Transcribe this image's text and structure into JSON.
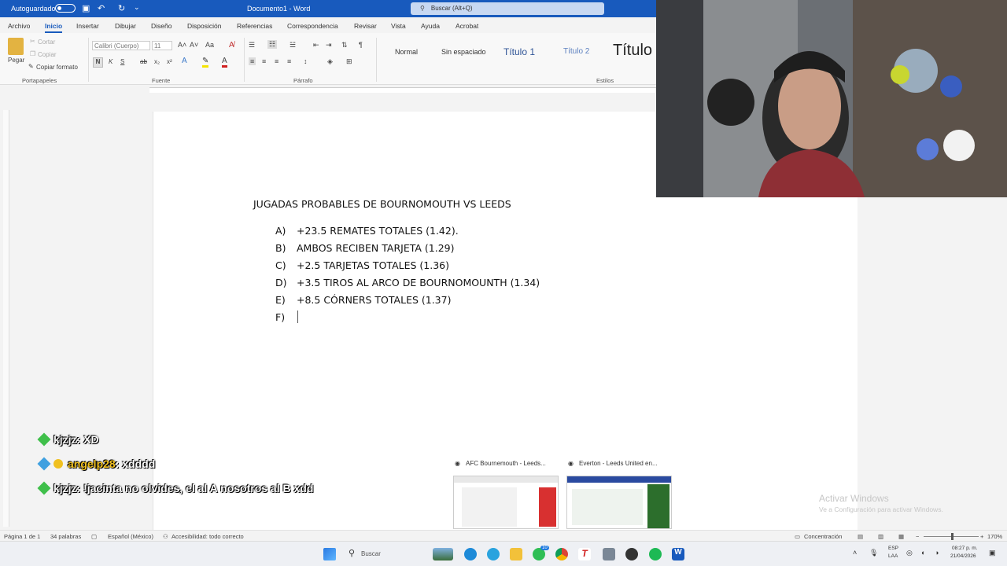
{
  "titlebar": {
    "autosave_label": "Autoguardado",
    "doc_title": "Documento1 - Word",
    "search_placeholder": "Buscar (Alt+Q)"
  },
  "menu": {
    "tabs": [
      "Archivo",
      "Inicio",
      "Insertar",
      "Dibujar",
      "Diseño",
      "Disposición",
      "Referencias",
      "Correspondencia",
      "Revisar",
      "Vista",
      "Ayuda",
      "Acrobat"
    ],
    "active": "Inicio"
  },
  "ribbon": {
    "clipboard": {
      "paste": "Pegar",
      "cut": "Cortar",
      "copy": "Copiar",
      "format_painter": "Copiar formato",
      "label": "Portapapeles"
    },
    "font": {
      "family": "Calibri (Cuerpo)",
      "size": "11",
      "label": "Fuente"
    },
    "paragraph": {
      "label": "Párrafo"
    },
    "styles": {
      "items": [
        "Normal",
        "Sin espaciado",
        "Título 1",
        "Título 2",
        "Título"
      ],
      "label": "Estilos"
    }
  },
  "document": {
    "heading": "JUGADAS PROBABLES DE BOURNOMOUTH VS LEEDS",
    "items": [
      {
        "marker": "A)",
        "text": "+23.5 REMATES TOTALES (1.42)."
      },
      {
        "marker": "B)",
        "text": "AMBOS RECIBEN TARJETA (1.29)"
      },
      {
        "marker": "C)",
        "text": "+2.5 TARJETAS TOTALES (1.36)"
      },
      {
        "marker": "D)",
        "text": "+3.5 TIROS AL ARCO DE BOURNOMOUNTH (1.34)"
      },
      {
        "marker": "E)",
        "text": "+8.5 CÓRNERS TOTALES (1.37)"
      },
      {
        "marker": "F)",
        "text": ""
      }
    ]
  },
  "chat": [
    {
      "user": "kjzjz",
      "message": "XD"
    },
    {
      "user": "angelp28",
      "message": "xdddd"
    },
    {
      "user": "kjzjz",
      "message": "!jacinta no olvides, el al A nosotros al B xdd"
    }
  ],
  "taskbar_previews": [
    {
      "title": "AFC Bournemouth - Leeds..."
    },
    {
      "title": "Everton - Leeds United en..."
    }
  ],
  "watermark": {
    "title": "Activar Windows",
    "subtitle": "Ve a Configuración para activar Windows."
  },
  "statusbar": {
    "page": "Página 1 de 1",
    "words": "34 palabras",
    "language": "Español (México)",
    "accessibility": "Accesibilidad: todo correcto",
    "focus": "Concentración",
    "zoom": "170%"
  },
  "taskbar": {
    "search_placeholder": "Buscar",
    "whatsapp_badge": "10",
    "lang_top": "ESP",
    "lang_bottom": "LAA",
    "time": "08:27 p. m.",
    "date": "21/04/2026"
  }
}
